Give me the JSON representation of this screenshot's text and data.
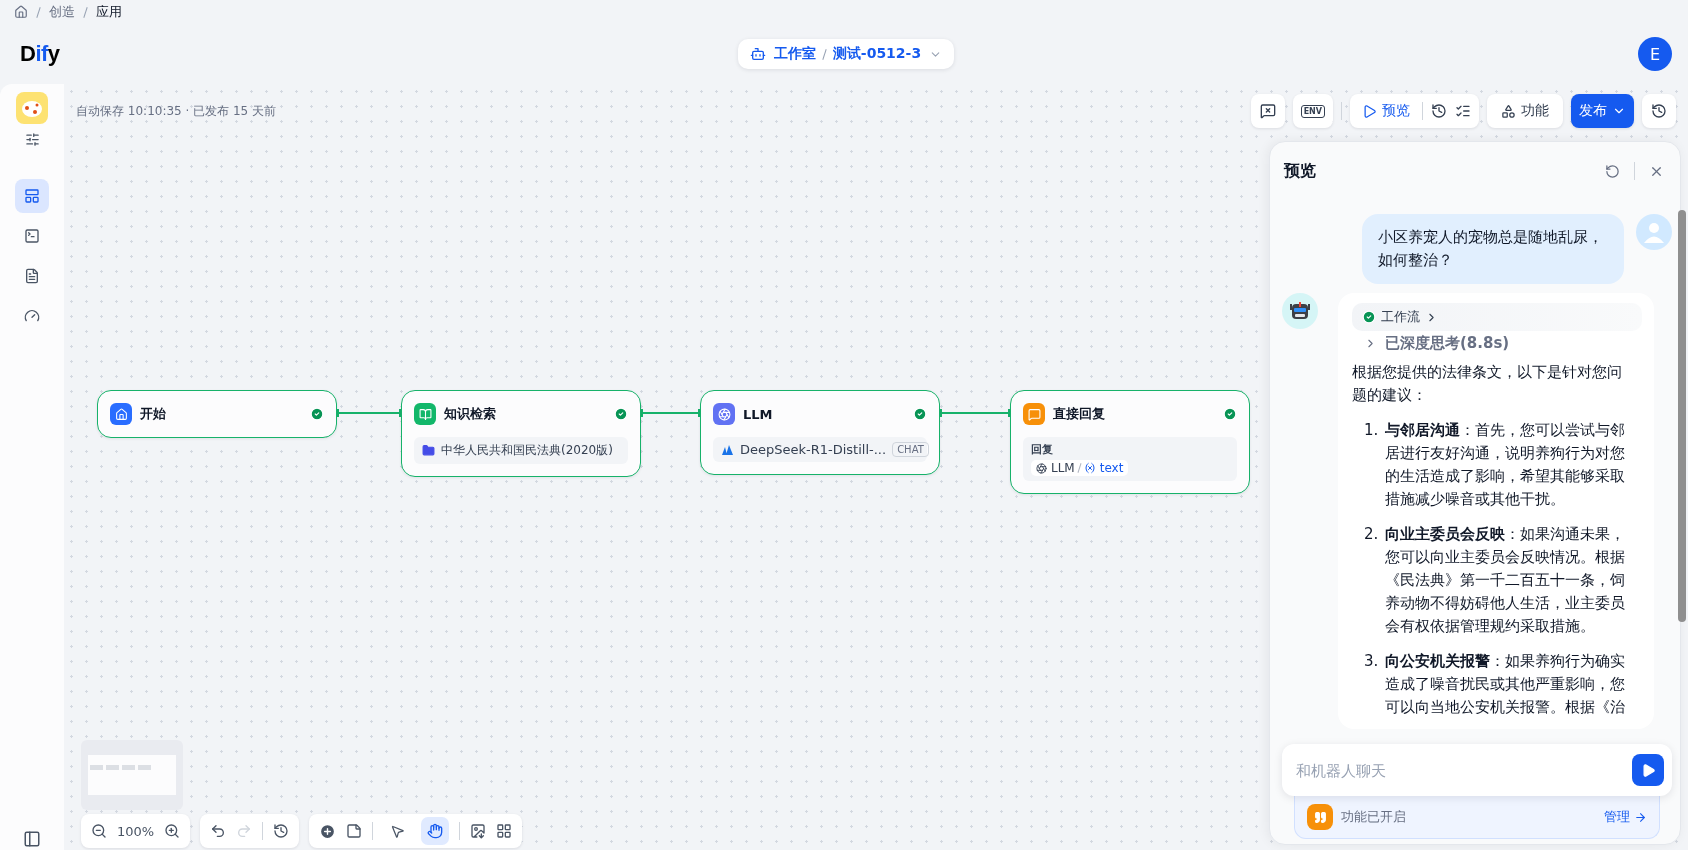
{
  "breadcrumb": {
    "items": [
      {
        "label": "创造",
        "current": false
      },
      {
        "label": "应用",
        "current": true
      }
    ]
  },
  "header": {
    "logo": [
      {
        "text": "D",
        "accent": false
      },
      {
        "text": "if",
        "accent": true
      },
      {
        "text": "y",
        "accent": false
      }
    ],
    "workspace": "工作室",
    "app_name": "测试-0512-3",
    "avatar": "E"
  },
  "sidebar": {
    "items": [
      {
        "selected": true
      },
      {
        "selected": false
      },
      {
        "selected": false
      },
      {
        "selected": false
      }
    ]
  },
  "canvas": {
    "status": "自动保存 10:10:35 · 已发布 15 天前",
    "toolbar": {
      "env": "ENV",
      "preview": "预览",
      "features": "功能",
      "publish": "发布"
    },
    "nodes": [
      {
        "kind": "start",
        "title": "开始",
        "done": true
      },
      {
        "kind": "knowledge",
        "title": "知识检索",
        "done": true,
        "dataset": "中华人民共和国民法典(2020版)"
      },
      {
        "kind": "llm",
        "title": "LLM",
        "done": true,
        "model": "DeepSeek-R1-Distill-...",
        "mode": "CHAT"
      },
      {
        "kind": "answer",
        "title": "直接回复",
        "done": true,
        "field_label": "回复",
        "source": "LLM",
        "variable": "text"
      }
    ],
    "zoom": "100%",
    "redo_disabled": true,
    "tool_modes": [
      {
        "selected": false
      },
      {
        "selected": true
      }
    ]
  },
  "preview": {
    "title": "预览",
    "user_message": "小区养宠人的宠物总是随地乱尿，如何整治？",
    "answer": {
      "workflow": {
        "label": "工作流",
        "done": true
      },
      "thinking": "已深度思考(8.8s)",
      "intro": "根据您提供的法律条文，以下是针对您问题的建议：",
      "items": [
        {
          "number": "1.",
          "text": "**与邻居沟通**：首先，您可以尝试与邻居进行友好沟通，说明养狗行为对您的生活造成了影响，希望其能够采取措施减少噪音或其他干扰。"
        },
        {
          "number": "2.",
          "text": "**向业主委员会反映**：如果沟通未果，您可以向业主委员会反映情况。根据《民法典》第一千二百五十一条，饲养动物不得妨碍他人生活，业主委员会有权依据管理规约采取措施。"
        },
        {
          "number": "3.",
          "text": "**向公安机关报警**：如果养狗行为确实造成了噪音扰民或其他严重影响，您可以向当地公安机关报警。根据《治"
        }
      ]
    },
    "input": {
      "placeholder": "和机器人聊天"
    },
    "features": {
      "label": "功能已开启",
      "action": "管理"
    }
  }
}
